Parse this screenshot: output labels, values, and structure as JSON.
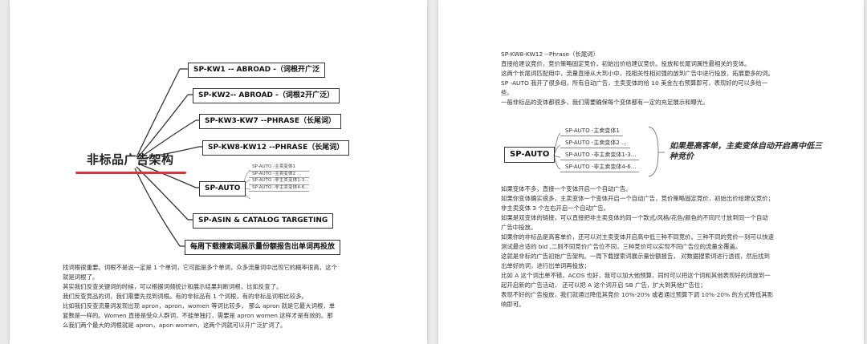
{
  "left": {
    "root": "非标品广告架构",
    "keywords": [
      "SP-KW1 -- ABROAD -（词根开广泛",
      "SP-KW2-- ABROAD -（词根2开广泛）",
      "SP-KW3-KW7 --PHRASE（长尾词）",
      "SP-KW8-KW12 --PHRASE（长尾词）",
      "SP-AUTO",
      "SP-ASIN & CATALOG TARGETING",
      "每周下载搜索词展示量份额报告出单词再投放"
    ],
    "auto_leaves": [
      "SP-AUTO -主卖变体1",
      "SP-AUTO -主卖变体2 ...",
      "SP-AUTO -非主卖变体1-3...",
      "SP-AUTO -非主卖变体4-6..."
    ],
    "paragraph": [
      "找词根很重要。词根不是说一定是 1 个单词，它可能是多个单词，众多流量词中出现它的概率很高，这个",
      "就是词根了。",
      "其实我们反查关键词的时候，可以根据词频统计和展示结果判断词根，比如反查了。",
      "我们反查竞品的词，我们需要先找到词根。有的非标品有 1 个词根，有的非标品词根比较多。",
      "比如我们反查流量词发现出现 apron，apron，women 等词比较多，  那么 apron 就是它最大词根，单",
      "复数是一样的。Women 直接是受众人群词，不能单独打，需要是 apron women 这样才是有效的。那",
      "么我们两个最大的词根就是 apron，apon women，这两个词就可以开广泛扩词了。"
    ]
  },
  "right": {
    "heading": "SP-KW8-KW12 --Phrase（长尾词）",
    "top_lines": [
      "直接给建议竞价，竞价策略固定竞价，初始出价给建议竞价。投放和长尾词属性最相关的变体。",
      "这两个长尾词匹配用中，流量直接从大到小中，找相关性相对强的放到广告中进行投放，拓展更多的词。",
      "SP -AUTO  我开了很多组，所有自动广告，主卖变体的给 10 美金左右预算即可，表现好的可以多给一",
      "些。",
      "一般非标品的变体都很多，我们需要确保每个变体都有一定的充足展示和曝光。"
    ],
    "auto_label": "SP-AUTO",
    "auto_leaves": [
      "SP-AUTO -主卖变体1",
      "SP-AUTO -主卖变体2 ...",
      "SP-AUTO -非主卖变体1-3...",
      "SP-AUTO -非主卖变体4-6..."
    ],
    "note": "如果是高客单，主卖变体自动开启高中低三种竞价",
    "bottom_lines": [
      "如果变体不多，直接一个变体开启一个自动广告。",
      "如果你变体确实很多，主卖变体一个变体开启一个自动广告，竞价策略固定竞价，初始出价给建议竞价；",
      "非主卖变体 3 个左右开启一个自动广告。",
      "如果是双变体的链接，可以直接把非主卖变体的同一个款式/风格/花色/颜色的不同尺寸放到同一个自动",
      "广告中投放。",
      "如果你的非标品是高客单价，还可以对主卖变体开启高中低三种不同竞价。三种不同的竞价一刻可以快速",
      "测试最合适的 bid ,二则不同竞价广告位不同，三种竞价可以实现不同广告位的流量全覆盖。",
      "这就是非标的广告初始广告架构。一周下载搜索词展示量份额报告，  对数据搜索词进行透视，然后找到",
      "出单好的词，进行出单词再投放；",
      "比如 A 这个词出单不错，ACOS 也好，我可以加大他预算，同时可以把这个词和其他表现好的词放到一",
      "起开启新的广告活动，  还可以把 A 这个词开启 SB 广告，扩大到其他广告位；",
      "表现不好的广告投放，我们就通过降低其竞价 10%-20% 或者通过预算下调 10%-20% 的方式降低其影",
      "响即可。"
    ]
  }
}
